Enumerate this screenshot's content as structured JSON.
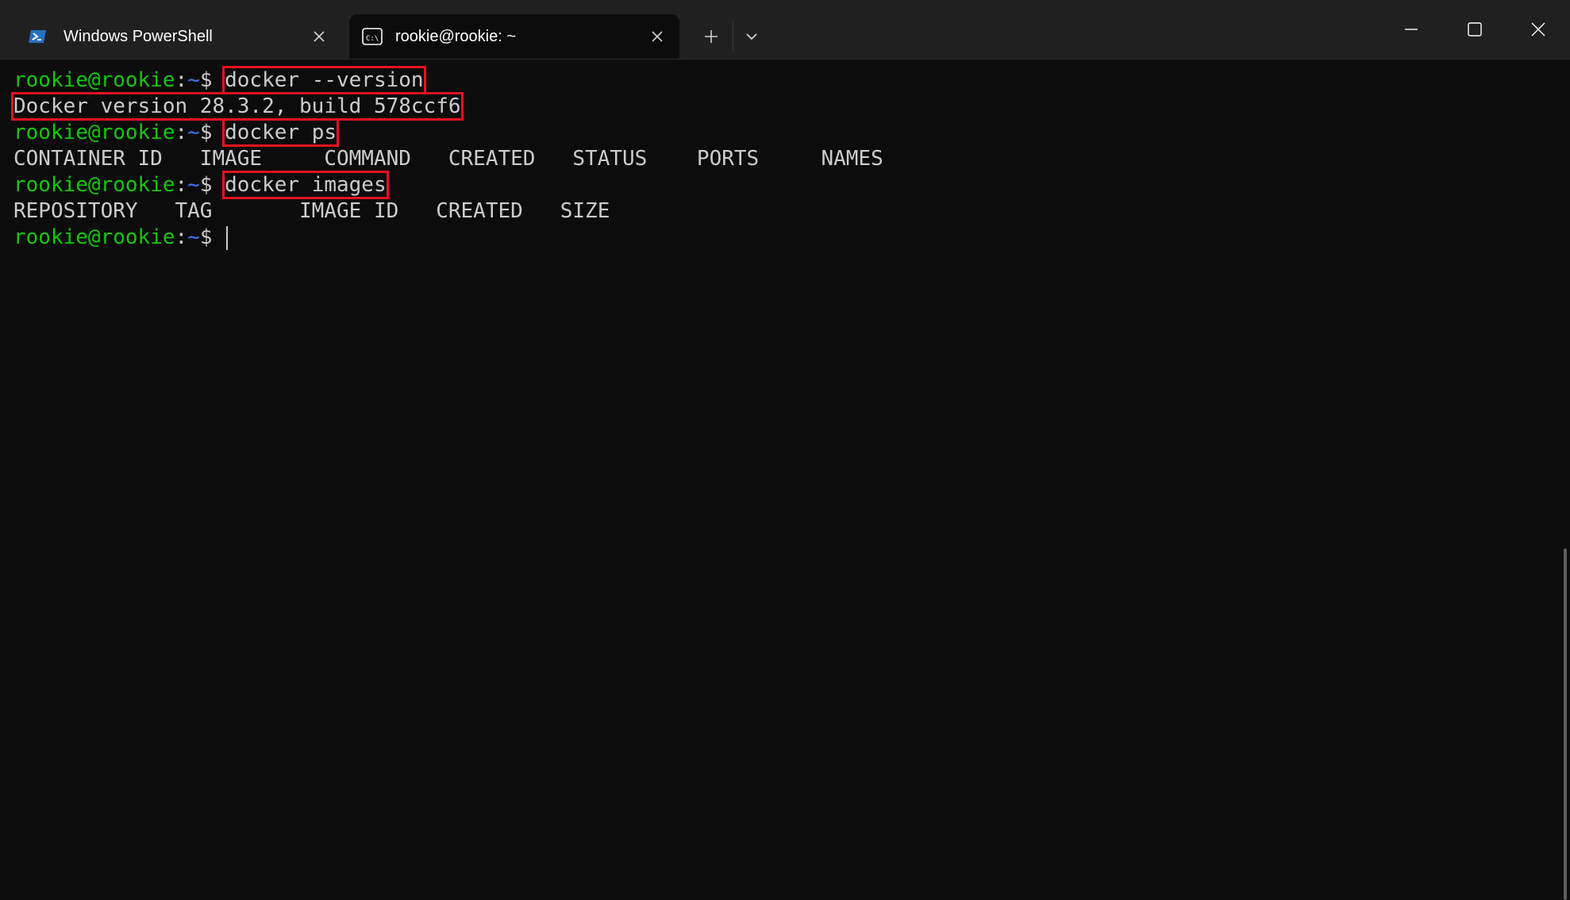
{
  "tabs": [
    {
      "label": "Windows PowerShell",
      "icon": "powershell-icon",
      "active": false
    },
    {
      "label": "rookie@rookie: ~",
      "icon": "terminal-icon",
      "active": true
    }
  ],
  "terminal": {
    "lines": [
      {
        "user": "rookie@rookie",
        "sep": ":",
        "path": "~",
        "prompt": "$",
        "command": "docker --version"
      },
      {
        "output": "Docker version 28.3.2, build 578ccf6"
      },
      {
        "user": "rookie@rookie",
        "sep": ":",
        "path": "~",
        "prompt": "$",
        "command": "docker ps"
      },
      {
        "output": "CONTAINER ID   IMAGE     COMMAND   CREATED   STATUS    PORTS     NAMES"
      },
      {
        "user": "rookie@rookie",
        "sep": ":",
        "path": "~",
        "prompt": "$",
        "command": "docker images"
      },
      {
        "output": "REPOSITORY   TAG       IMAGE ID   CREATED   SIZE"
      },
      {
        "user": "rookie@rookie",
        "sep": ":",
        "path": "~",
        "prompt": "$",
        "command": ""
      }
    ]
  },
  "colors": {
    "prompt_user": "#16c60c",
    "prompt_path": "#3b78ff",
    "highlight_box": "#e81123",
    "background": "#0c0c0c"
  }
}
